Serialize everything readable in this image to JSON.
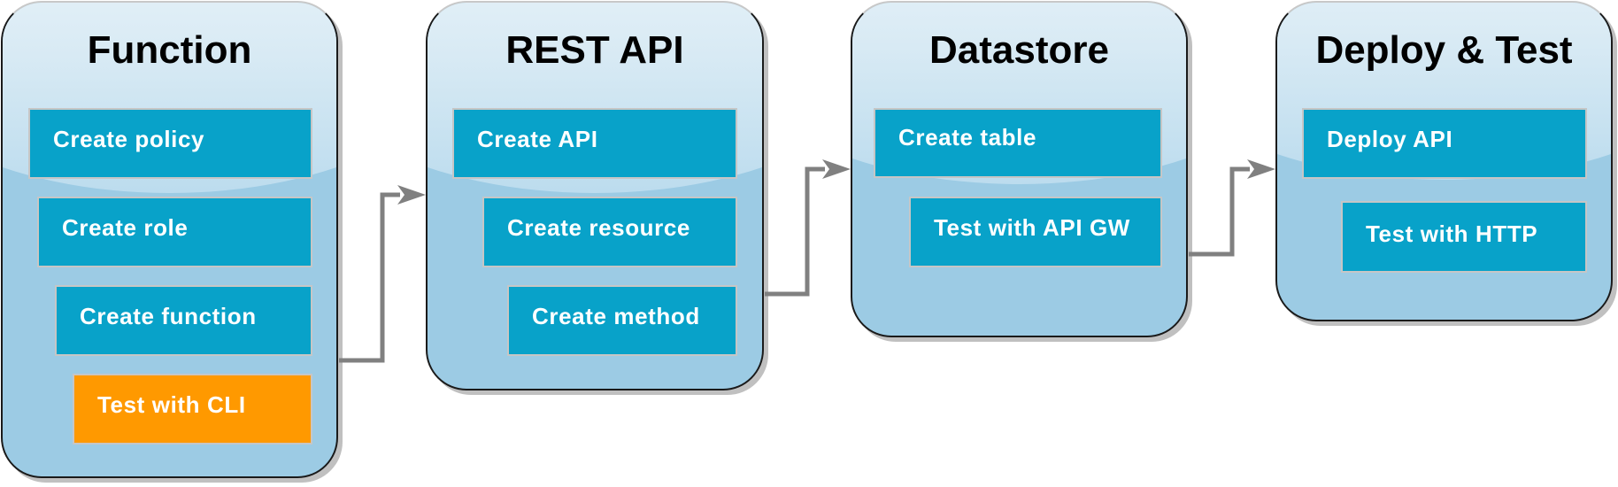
{
  "colors": {
    "panel_fill": "#9ccbe4",
    "step_fill": "#08a2c9",
    "step_active_fill": "#ff9900",
    "connector": "#808080"
  },
  "panels": [
    {
      "title": "Function",
      "steps": [
        {
          "label": "Create policy",
          "active": false
        },
        {
          "label": "Create role",
          "active": false
        },
        {
          "label": "Create function",
          "active": false
        },
        {
          "label": "Test with CLI",
          "active": true
        }
      ]
    },
    {
      "title": "REST API",
      "steps": [
        {
          "label": "Create API",
          "active": false
        },
        {
          "label": "Create resource",
          "active": false
        },
        {
          "label": "Create method",
          "active": false
        }
      ]
    },
    {
      "title": "Datastore",
      "steps": [
        {
          "label": "Create table",
          "active": false
        },
        {
          "label": "Test with API GW",
          "active": false
        }
      ]
    },
    {
      "title": "Deploy & Test",
      "steps": [
        {
          "label": "Deploy API",
          "active": false
        },
        {
          "label": "Test with HTTP",
          "active": false
        }
      ]
    }
  ],
  "connectors": [
    {
      "from": "Function",
      "to": "REST API"
    },
    {
      "from": "REST API",
      "to": "Datastore"
    },
    {
      "from": "Datastore",
      "to": "Deploy & Test"
    }
  ]
}
